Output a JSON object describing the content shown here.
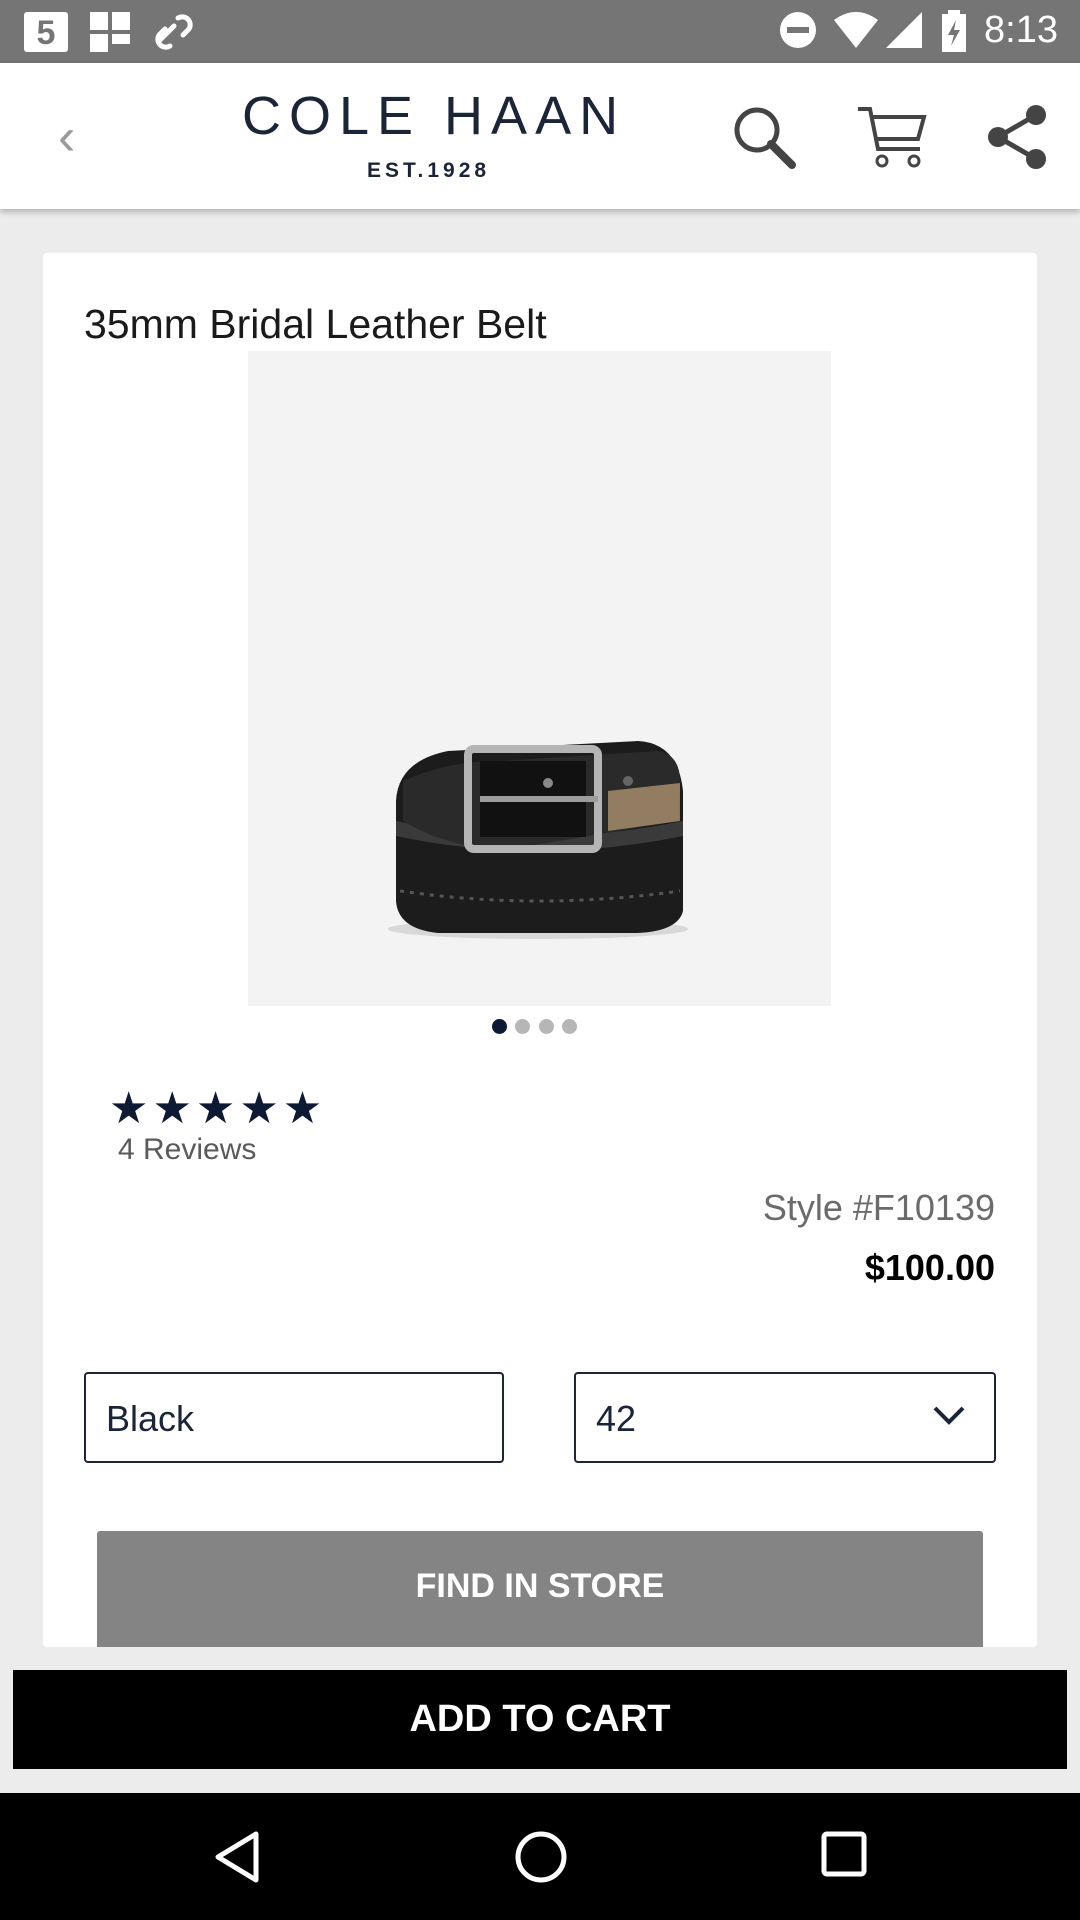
{
  "status_bar": {
    "time": "8:13",
    "left_icons": [
      "notification-5-icon",
      "grid-app-icon",
      "link-icon"
    ],
    "right_icons": [
      "do-not-disturb-icon",
      "wifi-icon",
      "signal-icon",
      "battery-charging-icon"
    ]
  },
  "header": {
    "brand_name": "COLE HAAN",
    "brand_est": "EST.1928",
    "icons": [
      "back-chevron-icon",
      "search-icon",
      "cart-icon",
      "share-icon"
    ],
    "back_glyph": "‹"
  },
  "product": {
    "title": "35mm Bridal Leather Belt",
    "image_count": 4,
    "active_image": 1,
    "rating": 4.5,
    "stars_glyph": "★★★★★",
    "reviews": "4 Reviews",
    "style": "Style #F10139",
    "price": "$100.00",
    "color_value": "Black",
    "size_value": "42"
  },
  "actions": {
    "find_in_store": "FIND IN STORE",
    "add_to_cart": "ADD TO CART"
  },
  "colors": {
    "brand_navy": "#1b2537",
    "status_bar": "#757575",
    "find_button": "#848484",
    "cart_button": "#000000"
  },
  "nav_bar": {
    "icons": [
      "back-triangle-icon",
      "home-circle-icon",
      "recents-square-icon"
    ]
  }
}
